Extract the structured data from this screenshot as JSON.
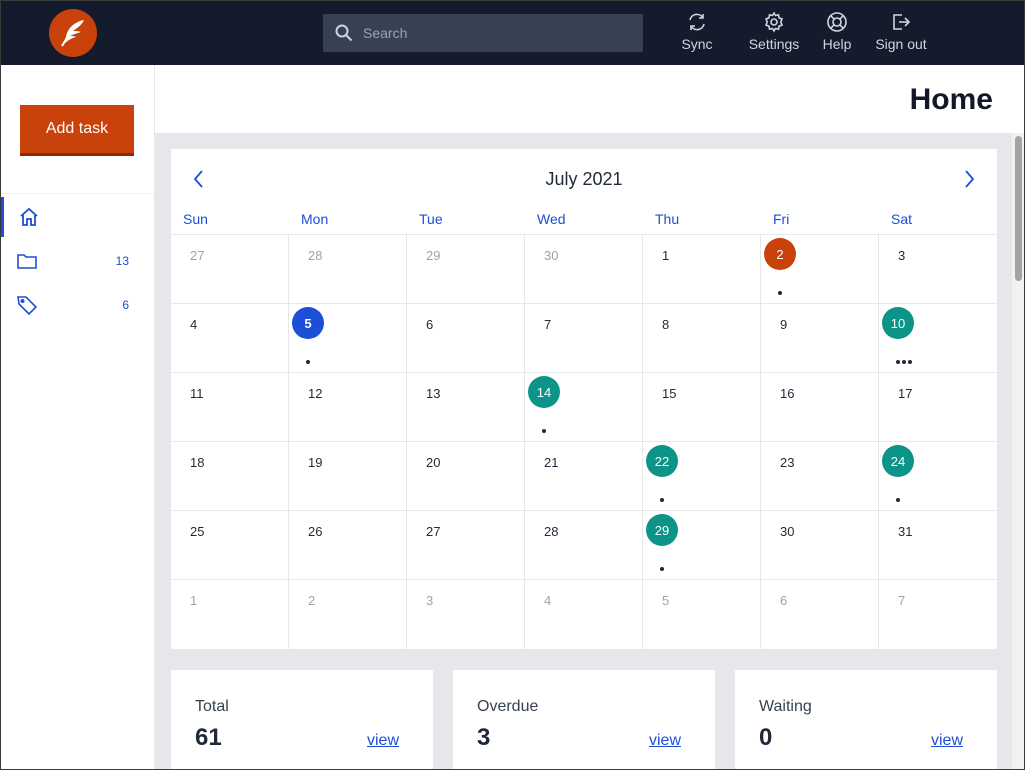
{
  "topbar": {
    "search_placeholder": "Search",
    "buttons": [
      {
        "label": "Sync",
        "icon": "sync-icon"
      },
      {
        "label": "Settings",
        "icon": "gear-icon"
      },
      {
        "label": "Help",
        "icon": "lifebuoy-icon"
      },
      {
        "label": "Sign out",
        "icon": "sign-out-icon"
      }
    ]
  },
  "sidebar": {
    "add_task_label": "Add task",
    "items": [
      {
        "icon": "home-icon",
        "count": ""
      },
      {
        "icon": "folder-icon",
        "count": "13"
      },
      {
        "icon": "tag-icon",
        "count": "6"
      }
    ]
  },
  "page": {
    "title": "Home"
  },
  "calendar": {
    "month_label": "July 2021",
    "weekdays": [
      "Sun",
      "Mon",
      "Tue",
      "Wed",
      "Thu",
      "Fri",
      "Sat"
    ],
    "weeks": [
      [
        {
          "d": "27",
          "muted": true
        },
        {
          "d": "28",
          "muted": true
        },
        {
          "d": "29",
          "muted": true
        },
        {
          "d": "30",
          "muted": true
        },
        {
          "d": "1"
        },
        {
          "d": "2",
          "highlight": "today",
          "dots": 1
        },
        {
          "d": "3"
        }
      ],
      [
        {
          "d": "4"
        },
        {
          "d": "5",
          "highlight": "selected",
          "dots": 1
        },
        {
          "d": "6"
        },
        {
          "d": "7"
        },
        {
          "d": "8"
        },
        {
          "d": "9"
        },
        {
          "d": "10",
          "highlight": "due",
          "dots": 3
        }
      ],
      [
        {
          "d": "11"
        },
        {
          "d": "12"
        },
        {
          "d": "13"
        },
        {
          "d": "14",
          "highlight": "due",
          "dots": 1
        },
        {
          "d": "15"
        },
        {
          "d": "16"
        },
        {
          "d": "17"
        }
      ],
      [
        {
          "d": "18"
        },
        {
          "d": "19"
        },
        {
          "d": "20"
        },
        {
          "d": "21"
        },
        {
          "d": "22",
          "highlight": "due",
          "dots": 1
        },
        {
          "d": "23"
        },
        {
          "d": "24",
          "highlight": "due",
          "dots": 1
        }
      ],
      [
        {
          "d": "25"
        },
        {
          "d": "26"
        },
        {
          "d": "27"
        },
        {
          "d": "28"
        },
        {
          "d": "29",
          "highlight": "due",
          "dots": 1
        },
        {
          "d": "30"
        },
        {
          "d": "31"
        }
      ],
      [
        {
          "d": "1",
          "muted": true
        },
        {
          "d": "2",
          "muted": true
        },
        {
          "d": "3",
          "muted": true
        },
        {
          "d": "4",
          "muted": true
        },
        {
          "d": "5",
          "muted": true
        },
        {
          "d": "6",
          "muted": true
        },
        {
          "d": "7",
          "muted": true
        }
      ]
    ]
  },
  "stats": [
    {
      "label": "Total",
      "value": "61",
      "link": "view"
    },
    {
      "label": "Overdue",
      "value": "3",
      "link": "view"
    },
    {
      "label": "Waiting",
      "value": "0",
      "link": "view"
    }
  ],
  "colors": {
    "brand": "#c9410b",
    "accent": "#1d4ed8",
    "due": "#0d9488",
    "topbar": "#141b2d"
  }
}
